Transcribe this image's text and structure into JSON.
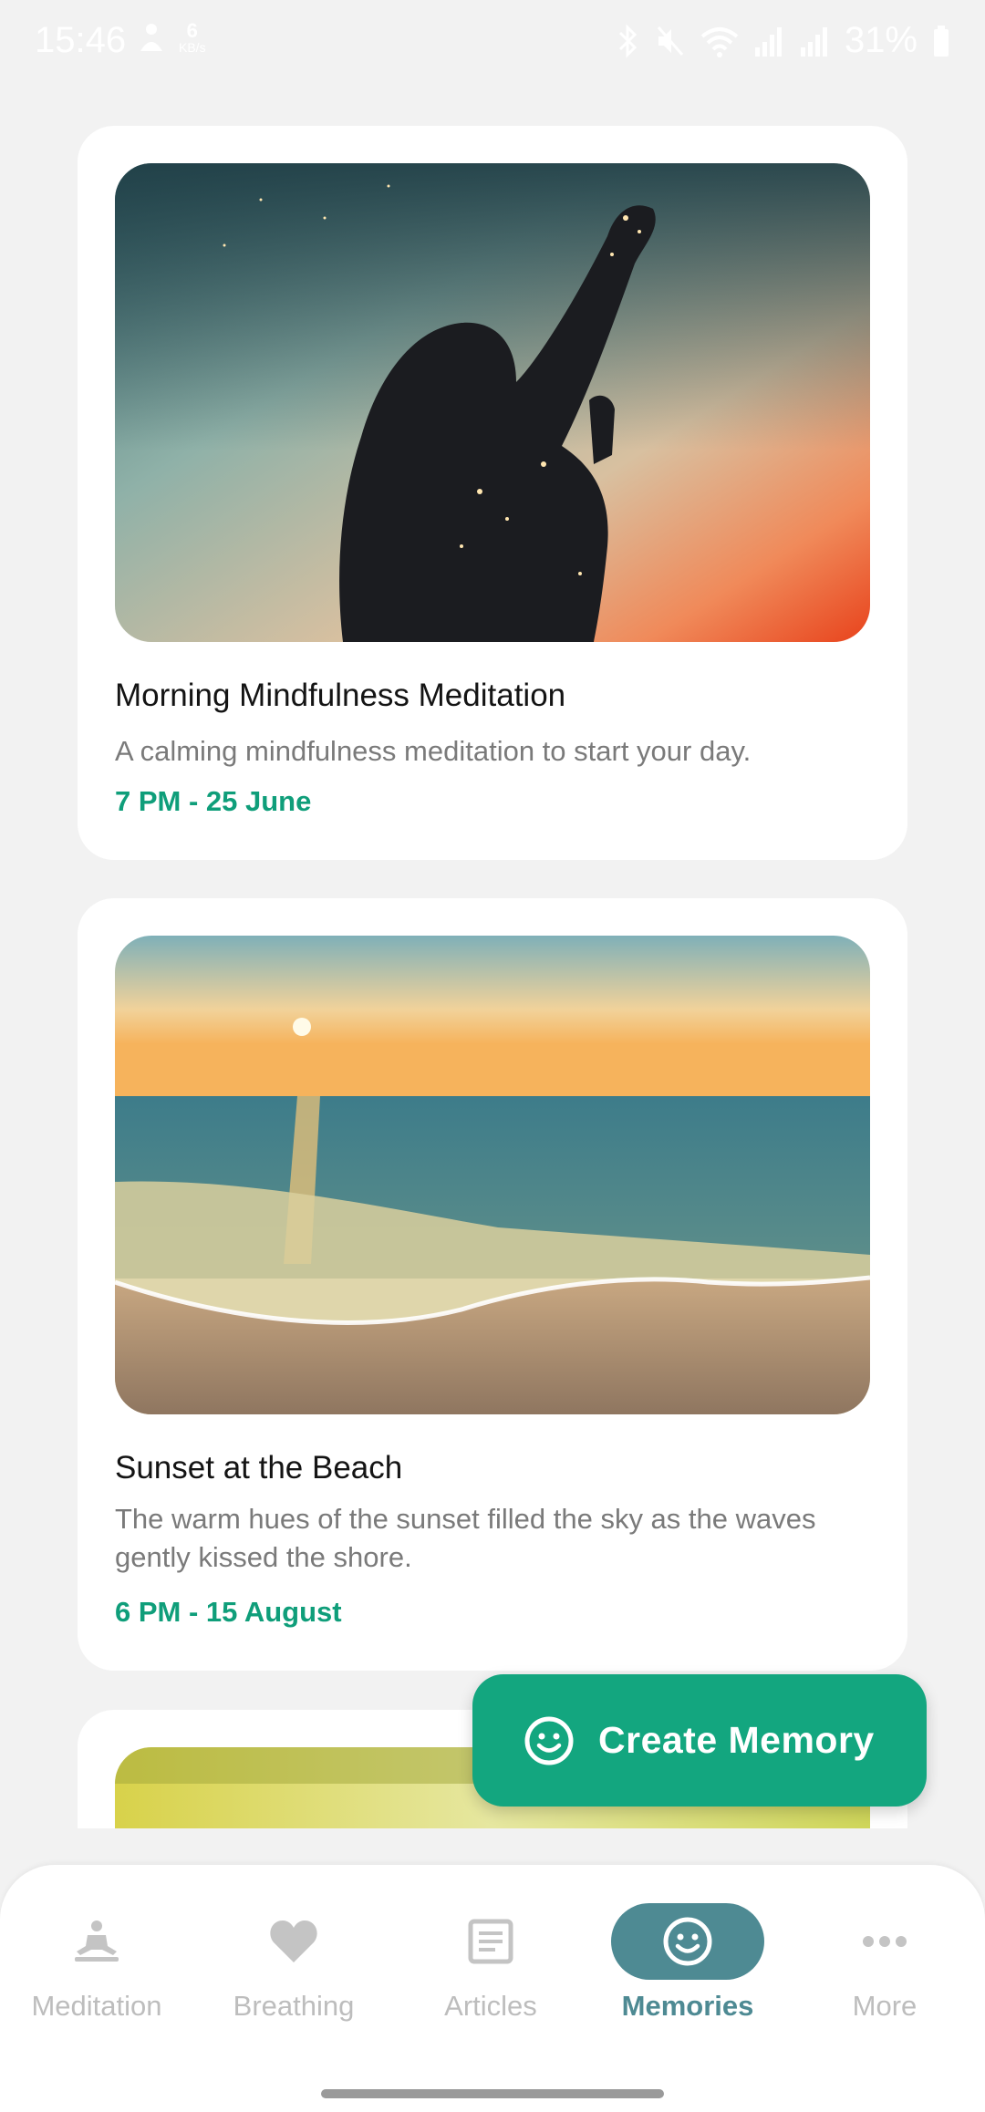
{
  "status_bar": {
    "time": "15:46",
    "net_speed": "6",
    "net_unit": "KB/s",
    "battery": "31%",
    "icons": [
      "bluetooth-icon",
      "mute-icon",
      "wifi-icon",
      "signal-icon",
      "signal-icon",
      "battery-icon"
    ]
  },
  "memories": [
    {
      "title": "Morning Mindfulness Meditation",
      "description": "A calming mindfulness meditation to start your day.",
      "date": "7 PM - 25 June",
      "image": "silhouette-woman-sunset"
    },
    {
      "title": "Sunset at the Beach",
      "description": "The warm hues of the sunset filled the sky as the waves gently kissed the shore.",
      "date": "6 PM - 15 August",
      "image": "beach-sunset"
    },
    {
      "image": "yellow-field-blurred"
    }
  ],
  "fab": {
    "label": "Create Memory",
    "icon": "smiley-icon",
    "color": "#13a67f"
  },
  "nav": {
    "items": [
      {
        "label": "Meditation",
        "icon": "meditation-icon",
        "active": false
      },
      {
        "label": "Breathing",
        "icon": "heart-icon",
        "active": false
      },
      {
        "label": "Articles",
        "icon": "article-icon",
        "active": false
      },
      {
        "label": "Memories",
        "icon": "smiley-icon",
        "active": true
      },
      {
        "label": "More",
        "icon": "more-icon",
        "active": false
      }
    ],
    "active_color": "#4e8a93",
    "inactive_color": "#bdbdbd"
  }
}
